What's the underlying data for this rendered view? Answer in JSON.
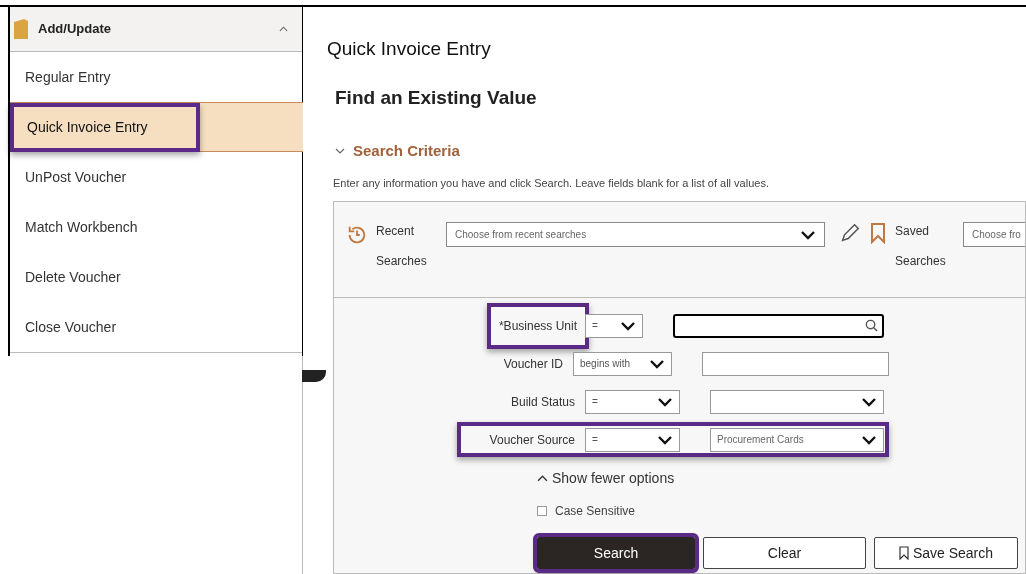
{
  "sidebar": {
    "header": {
      "label": "Add/Update",
      "expanded": true
    },
    "items": [
      {
        "label": "Regular Entry",
        "selected": false,
        "highlighted": false
      },
      {
        "label": "Quick Invoice Entry",
        "selected": true,
        "highlighted": true
      },
      {
        "label": "UnPost Voucher",
        "selected": false,
        "highlighted": false
      },
      {
        "label": "Match Workbench",
        "selected": false,
        "highlighted": false
      },
      {
        "label": "Delete Voucher",
        "selected": false,
        "highlighted": false
      },
      {
        "label": "Close Voucher",
        "selected": false,
        "highlighted": false
      }
    ]
  },
  "page_title": "Quick Invoice Entry",
  "heading": "Find an Existing Value",
  "search_criteria": {
    "label": "Search Criteria",
    "expanded": true,
    "instructions": "Enter any information you have and click Search. Leave fields blank for a list of all values.",
    "recent": {
      "label_1": "Recent",
      "label_2": "Searches",
      "placeholder": "Choose from recent searches"
    },
    "saved": {
      "label_1": "Saved",
      "label_2": "Searches",
      "placeholder": "Choose fro"
    },
    "criteria": [
      {
        "label": "*Business Unit",
        "operator": "=",
        "kind": "lookup",
        "focused": true,
        "label_highlighted": true,
        "row_highlighted": false
      },
      {
        "label": "Voucher ID",
        "operator": "begins with",
        "kind": "text",
        "focused": false,
        "label_highlighted": false,
        "row_highlighted": false
      },
      {
        "label": "Build Status",
        "operator": "=",
        "kind": "select",
        "focused": false,
        "label_highlighted": false,
        "row_highlighted": false
      },
      {
        "label": "Voucher Source",
        "operator": "=",
        "kind": "select",
        "value": "Procurement Cards",
        "focused": false,
        "label_highlighted": false,
        "row_highlighted": true
      }
    ],
    "toggle": {
      "label": "Show fewer options",
      "expanded": true
    },
    "case_sensitive": {
      "label": "Case Sensitive",
      "checked": false
    },
    "buttons": [
      {
        "label": "Search",
        "kind": "primary",
        "highlighted": true
      },
      {
        "label": "Clear",
        "kind": "secondary",
        "highlighted": false
      },
      {
        "label": "Save Search",
        "kind": "save",
        "highlighted": false
      }
    ]
  }
}
